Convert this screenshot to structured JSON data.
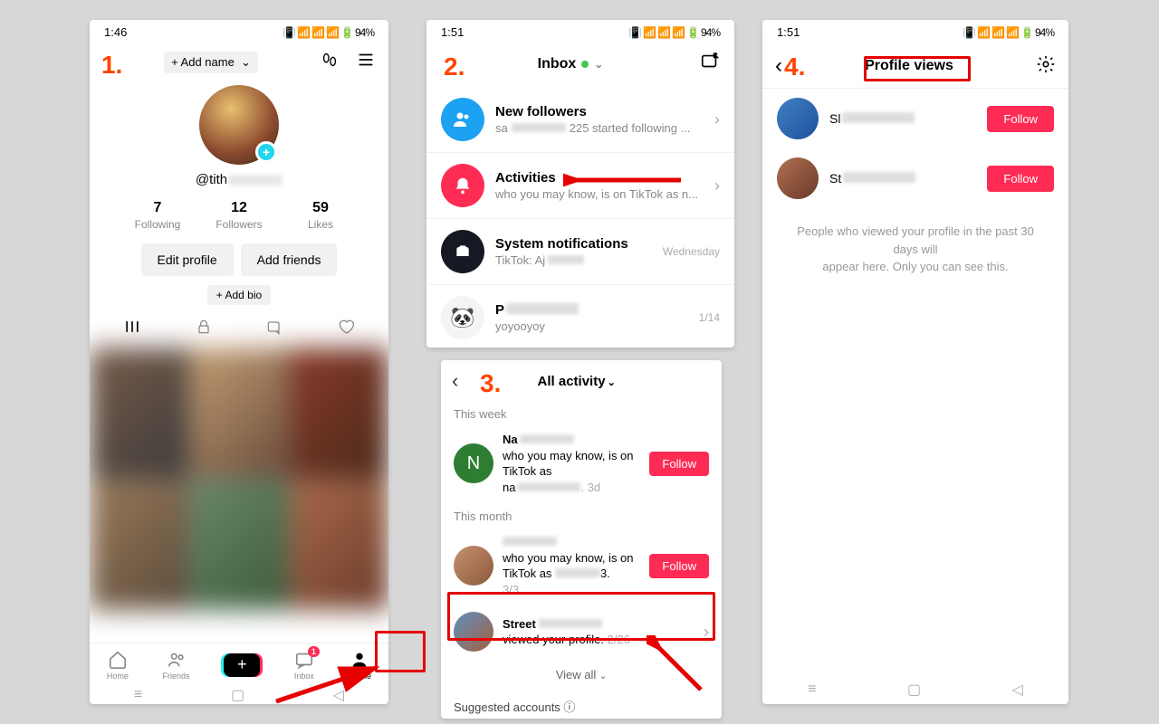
{
  "statusbar": {
    "time1": "1:46",
    "time2": "1:51",
    "battery": "94%"
  },
  "steps": {
    "s1": "1.",
    "s2": "2.",
    "s3": "3.",
    "s4": "4."
  },
  "p1": {
    "addname": "+ Add name",
    "handle": "@tith",
    "stats": {
      "following_n": "7",
      "following_l": "Following",
      "followers_n": "12",
      "followers_l": "Followers",
      "likes_n": "59",
      "likes_l": "Likes"
    },
    "edit": "Edit profile",
    "addfriends": "Add friends",
    "addbio": "+ Add bio",
    "bottom": {
      "home": "Home",
      "friends": "Friends",
      "inbox": "Inbox",
      "profile": "Profile",
      "badge": "1"
    }
  },
  "p2": {
    "title": "Inbox",
    "rows": [
      {
        "title": "New followers",
        "sub_a": "sa",
        "sub_b": "225 started following ..."
      },
      {
        "title": "Activities",
        "sub": "who you may know, is on TikTok as n..."
      },
      {
        "title": "System notifications",
        "sub": "TikTok: Aj",
        "time": "Wednesday"
      },
      {
        "title": "P",
        "sub": "yoyooyoy",
        "time": "1/14"
      }
    ]
  },
  "p3": {
    "title": "All activity",
    "week": "This week",
    "month": "This month",
    "r1": {
      "name": "Na",
      "sub1": "who you may know, is on",
      "sub2": "TikTok as",
      "sub3": "na",
      "time": ". 3d"
    },
    "r2": {
      "sub1": "who you may know, is on",
      "sub2": "TikTok as",
      "time": "3/3"
    },
    "r3": {
      "name": "Street",
      "sub": "viewed your profile.",
      "time": "2/26"
    },
    "follow": "Follow",
    "viewall": "View all",
    "sugg": "Suggested accounts"
  },
  "p4": {
    "title": "Profile views",
    "u1": "Sl",
    "u2": "St",
    "follow": "Follow",
    "hint1": "People who viewed your profile in the past 30 days will",
    "hint2": "appear here. Only you can see this."
  }
}
